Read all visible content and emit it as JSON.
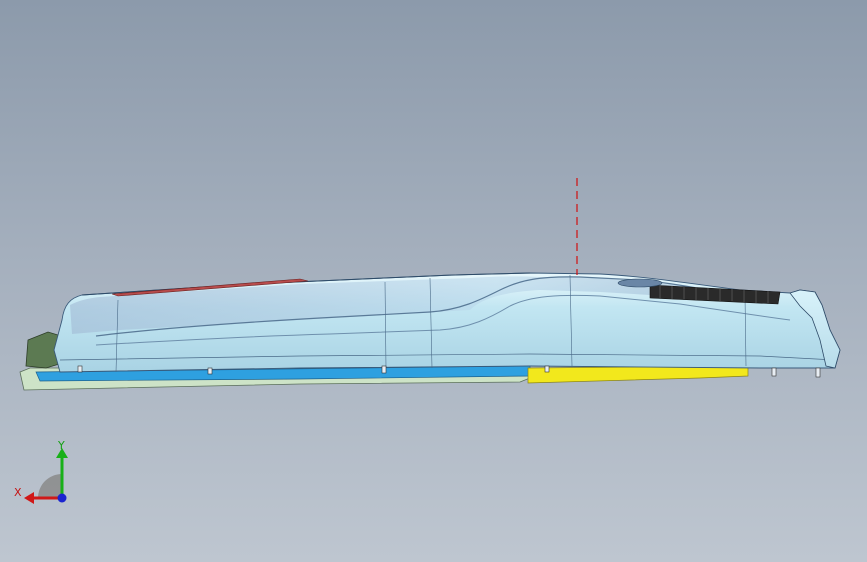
{
  "viewport": {
    "background_top": "#8c9aab",
    "background_bottom": "#bec6d0"
  },
  "model": {
    "shell_color": "#cfeef7",
    "shell_shadow_color": "#9ec8dc",
    "base_plate_color": "#cde3c7",
    "blue_insert_color": "#2ea0e0",
    "yellow_insert_color": "#f2e81c",
    "red_strip_color": "#b84c4c",
    "grille_color": "#2a2a2a",
    "end_cap_color": "#5c7a52",
    "centerline_color": "#d01010"
  },
  "triad": {
    "x_label": "X",
    "y_label": "Y",
    "x_color": "#d01818",
    "y_color": "#18b018",
    "z_color": "#1a24d0"
  }
}
